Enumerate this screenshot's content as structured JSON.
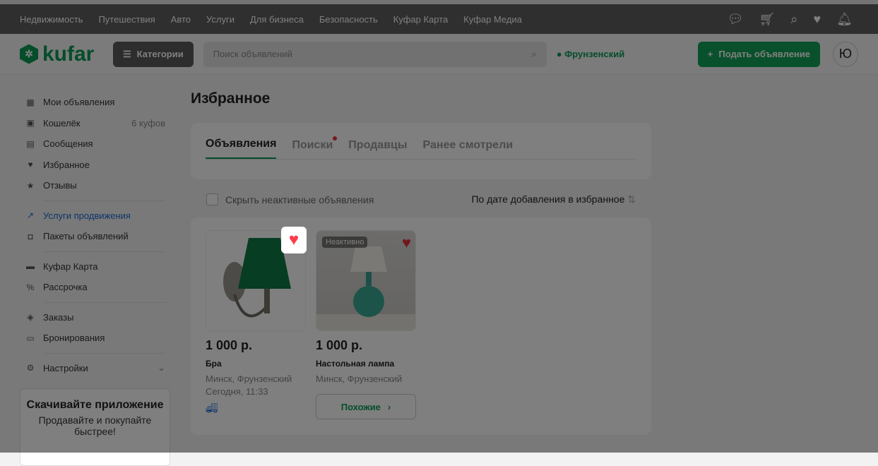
{
  "topnav": {
    "links": [
      "Недвижимость",
      "Путешествия",
      "Авто",
      "Услуги",
      "Для бизнеса",
      "Безопасность",
      "Куфар Карта",
      "Куфар Медиа"
    ]
  },
  "header": {
    "logo": "kufar",
    "categories": "Категории",
    "search_placeholder": "Поиск объявлений",
    "location": "Фрунзенский",
    "post": "Подать объявление",
    "avatar": "Ю"
  },
  "sidebar": {
    "items": [
      {
        "label": "Мои объявления",
        "icon": "▦"
      },
      {
        "label": "Кошелёк",
        "icon": "▣",
        "extra": "6 куфов"
      },
      {
        "label": "Сообщения",
        "icon": "▤"
      },
      {
        "label": "Избранное",
        "icon": "♥"
      },
      {
        "label": "Отзывы",
        "icon": "★"
      },
      {
        "label": "Услуги продвижения",
        "icon": "↗"
      },
      {
        "label": "Пакеты объявлений",
        "icon": "◘"
      },
      {
        "label": "Куфар Карта",
        "icon": "▬"
      },
      {
        "label": "Рассрочка",
        "icon": "%"
      },
      {
        "label": "Заказы",
        "icon": "◈"
      },
      {
        "label": "Бронирования",
        "icon": "▭"
      },
      {
        "label": "Настройки",
        "icon": "⚙"
      }
    ],
    "app_title": "Скачивайте приложение",
    "app_text": "Продавайте и покупайте быстрее!"
  },
  "main": {
    "title": "Избранное",
    "tabs": [
      "Объявления",
      "Поиски",
      "Продавцы",
      "Ранее смотрели"
    ],
    "hide_inactive": "Скрыть неактивные объявления",
    "sort": "По дате добавления в избранное",
    "cards": [
      {
        "price": "1 000 р.",
        "title": "Бра",
        "location": "Минск, Фрунзенский",
        "date": "Сегодня, 11:33"
      },
      {
        "price": "1 000 р.",
        "title": "Настольная лампа",
        "location": "Минск, Фрунзенский",
        "badge": "Неактивно",
        "similar": "Похожие"
      }
    ]
  }
}
